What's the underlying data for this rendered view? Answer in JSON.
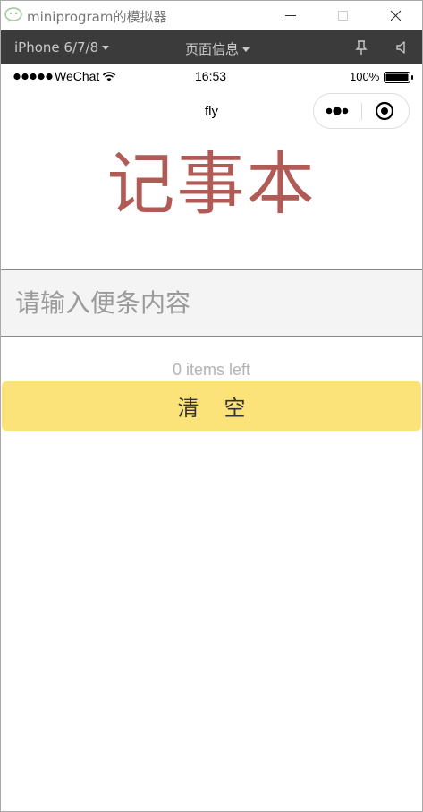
{
  "window": {
    "title": "miniprogram的模拟器"
  },
  "toolbar": {
    "device": "iPhone 6/7/8",
    "page_info": "页面信息",
    "icons": [
      "pin-icon",
      "sound-icon"
    ]
  },
  "statusbar": {
    "carrier": "WeChat",
    "time": "16:53",
    "battery": "100%"
  },
  "navbar": {
    "title": "fly"
  },
  "app": {
    "heading": "记事本",
    "input_placeholder": "请输入便条内容",
    "items_left": "0 items left",
    "clear_label": "清空"
  },
  "colors": {
    "heading": "#b05b55",
    "clear_button": "#fbe37a",
    "toolbar": "#3b3b3b"
  }
}
